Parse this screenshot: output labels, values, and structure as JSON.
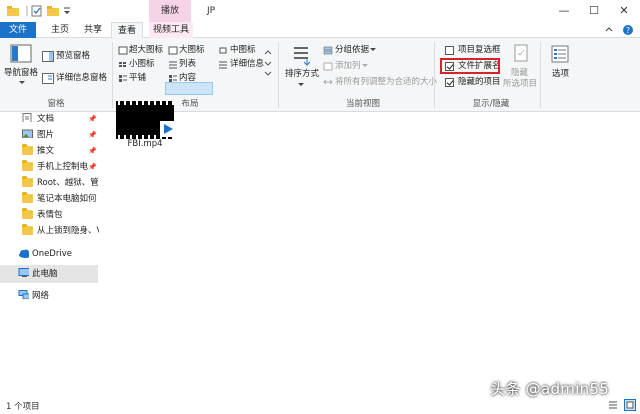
{
  "titlebar": {
    "context_tab": "播放",
    "window_title": "JP",
    "minimize": "—",
    "maximize": "☐",
    "close": "✕"
  },
  "tabs": {
    "file": "文件",
    "home": "主页",
    "share": "共享",
    "view": "查看",
    "video_tools": "视频工具"
  },
  "ribbon": {
    "panes": {
      "nav_pane": "导航窗格",
      "preview_pane": "预览窗格",
      "details_pane": "详细信息窗格",
      "group_label": "窗格"
    },
    "layout": {
      "extra_large": "超大图标",
      "large": "大图标",
      "medium": "中图标",
      "small": "小图标",
      "list": "列表",
      "details": "详细信息",
      "tiles": "平铺",
      "content": "内容",
      "group_label": "布局"
    },
    "current_view": {
      "sort_by": "排序方式",
      "group_by": "分组依据",
      "add_columns": "添加列",
      "size_columns": "将所有列调整为合适的大小",
      "group_label": "当前视图"
    },
    "show_hide": {
      "item_checkboxes": "项目复选框",
      "file_extensions": "文件扩展名",
      "hidden_items": "隐藏的项目",
      "hide": "隐藏",
      "selected_items": "所选项目",
      "group_label": "显示/隐藏"
    },
    "options": "选项"
  },
  "nav": {
    "items": [
      {
        "label": "文档"
      },
      {
        "label": "图片"
      },
      {
        "label": "推文"
      },
      {
        "label": "手机上控制电"
      },
      {
        "label": "Root、越狱、管"
      },
      {
        "label": "笔记本电脑如何"
      },
      {
        "label": "表情包"
      },
      {
        "label": "从上锁到隐身、V"
      }
    ],
    "onedrive": "OneDrive",
    "this_pc": "此电脑",
    "network": "网络"
  },
  "content": {
    "files": [
      {
        "name": "FBI.mp4"
      }
    ]
  },
  "status": {
    "count": "1 个项目"
  },
  "watermark": "头条 @admin55",
  "colors": {
    "accent": "#1a73c8",
    "context_tab": "#f6d4e8",
    "highlight_box": "#d9232a",
    "folder": "#f6c64a"
  }
}
